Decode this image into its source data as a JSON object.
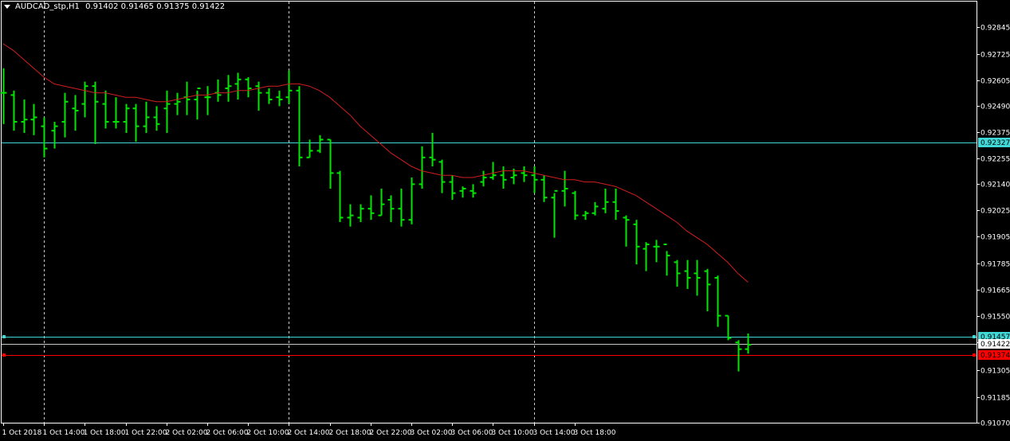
{
  "header": {
    "symbol": "AUDCAD_stp,H1",
    "ohlc": "0.91402 0.91465 0.91375 0.91422"
  },
  "colors": {
    "background": "#000000",
    "bar": "#00e600",
    "ma": "#d21e1e",
    "hline": "#40d7d7",
    "current": "#c8c8c8",
    "sell": "#ff0000",
    "axis": "#ffffff",
    "separator": "#c8c8c8"
  },
  "chart_data": {
    "type": "ohlc",
    "symbol": "AUDCAD_stp",
    "timeframe": "H1",
    "ylim": [
      0.9107,
      0.9292
    ],
    "yticks": [
      "0.92845",
      "0.92725",
      "0.92605",
      "0.92490",
      "0.92375",
      "0.92255",
      "0.92140",
      "0.92025",
      "0.91905",
      "0.91785",
      "0.91665",
      "0.91550",
      "0.91430",
      "0.91305",
      "0.91185",
      "0.91070"
    ],
    "xticks": [
      "1 Oct 2018",
      "1 Oct 14:00",
      "1 Oct 18:00",
      "1 Oct 22:00",
      "2 Oct 02:00",
      "2 Oct 06:00",
      "2 Oct 10:00",
      "2 Oct 14:00",
      "2 Oct 18:00",
      "2 Oct 22:00",
      "3 Oct 02:00",
      "3 Oct 06:00",
      "3 Oct 10:00",
      "3 Oct 14:00",
      "3 Oct 18:00"
    ],
    "x_start_hour": 10,
    "day_separators_hour": [
      14,
      38,
      62
    ],
    "bars": [
      [
        0.9255,
        0.9266,
        0.9241,
        0.9255
      ],
      [
        0.9254,
        0.9256,
        0.9238,
        0.9242
      ],
      [
        0.9242,
        0.9252,
        0.9237,
        0.9243
      ],
      [
        0.9243,
        0.925,
        0.9236,
        0.9244
      ],
      [
        0.924,
        0.9244,
        0.9226,
        0.923
      ],
      [
        0.9238,
        0.9242,
        0.923,
        0.924
      ],
      [
        0.9242,
        0.9255,
        0.9235,
        0.9251
      ],
      [
        0.9248,
        0.9254,
        0.9238,
        0.9247
      ],
      [
        0.925,
        0.926,
        0.9244,
        0.9258
      ],
      [
        0.9258,
        0.926,
        0.9232,
        0.9251
      ],
      [
        0.925,
        0.9256,
        0.9239,
        0.9242
      ],
      [
        0.9242,
        0.9253,
        0.9239,
        0.9242
      ],
      [
        0.9242,
        0.925,
        0.9237,
        0.9248
      ],
      [
        0.9248,
        0.925,
        0.9233,
        0.924
      ],
      [
        0.924,
        0.9251,
        0.9237,
        0.9244
      ],
      [
        0.9244,
        0.9249,
        0.9238,
        0.9241
      ],
      [
        0.9248,
        0.9256,
        0.9237,
        0.925
      ],
      [
        0.925,
        0.9255,
        0.9245,
        0.9251
      ],
      [
        0.9253,
        0.926,
        0.9245,
        0.9252
      ],
      [
        0.9252,
        0.9256,
        0.9243,
        0.9257
      ],
      [
        0.9253,
        0.9258,
        0.9245,
        0.9253
      ],
      [
        0.9255,
        0.9261,
        0.9251,
        0.9254
      ],
      [
        0.9257,
        0.9263,
        0.9251,
        0.9258
      ],
      [
        0.9259,
        0.9264,
        0.9252,
        0.9261
      ],
      [
        0.9261,
        0.9262,
        0.9253,
        0.9257
      ],
      [
        0.9258,
        0.926,
        0.9247,
        0.9255
      ],
      [
        0.9255,
        0.9257,
        0.925,
        0.9252
      ],
      [
        0.9253,
        0.9256,
        0.9249,
        0.9252
      ],
      [
        0.9253,
        0.9265,
        0.925,
        0.9256
      ],
      [
        0.9256,
        0.9258,
        0.9222,
        0.9226
      ],
      [
        0.9226,
        0.9234,
        0.9226,
        0.9229
      ],
      [
        0.9229,
        0.9236,
        0.9228,
        0.9234
      ],
      [
        0.9234,
        0.9234,
        0.9212,
        0.9219
      ],
      [
        0.9219,
        0.922,
        0.9197,
        0.9199
      ],
      [
        0.9199,
        0.9205,
        0.9195,
        0.92
      ],
      [
        0.9199,
        0.9205,
        0.9197,
        0.9203
      ],
      [
        0.9203,
        0.9209,
        0.9198,
        0.9201
      ],
      [
        0.92,
        0.9212,
        0.92,
        0.9205
      ],
      [
        0.9207,
        0.9209,
        0.9197,
        0.9203
      ],
      [
        0.9203,
        0.9212,
        0.9195,
        0.9198
      ],
      [
        0.9198,
        0.9217,
        0.9196,
        0.9214
      ],
      [
        0.9214,
        0.9231,
        0.9212,
        0.9226
      ],
      [
        0.9226,
        0.9237,
        0.9222,
        0.9225
      ],
      [
        0.9224,
        0.9225,
        0.921,
        0.9215
      ],
      [
        0.9215,
        0.9218,
        0.9207,
        0.921
      ],
      [
        0.9211,
        0.9213,
        0.9208,
        0.9212
      ],
      [
        0.9211,
        0.9214,
        0.9208,
        0.921
      ],
      [
        0.9215,
        0.922,
        0.9213,
        0.9217
      ],
      [
        0.9217,
        0.9224,
        0.9216,
        0.9218
      ],
      [
        0.9218,
        0.9222,
        0.9212,
        0.9216
      ],
      [
        0.9217,
        0.9221,
        0.9214,
        0.9218
      ],
      [
        0.9219,
        0.9222,
        0.9215,
        0.9218
      ],
      [
        0.9218,
        0.9222,
        0.921,
        0.9216
      ],
      [
        0.9216,
        0.9218,
        0.9206,
        0.9208
      ],
      [
        0.9208,
        0.921,
        0.919,
        0.9211
      ],
      [
        0.9211,
        0.922,
        0.9204,
        0.9212
      ],
      [
        0.921,
        0.9211,
        0.9198,
        0.92
      ],
      [
        0.92,
        0.9202,
        0.9198,
        0.9201
      ],
      [
        0.9201,
        0.9206,
        0.92,
        0.9204
      ],
      [
        0.9203,
        0.9212,
        0.9201,
        0.9206
      ],
      [
        0.9206,
        0.9212,
        0.9198,
        0.9202
      ],
      [
        0.9199,
        0.92,
        0.9186,
        0.9198
      ],
      [
        0.9196,
        0.9198,
        0.9178,
        0.9186
      ],
      [
        0.9185,
        0.9188,
        0.9175,
        0.9187
      ],
      [
        0.9186,
        0.9189,
        0.9179,
        0.9186
      ],
      [
        0.9187,
        0.9184,
        0.9173,
        0.9182
      ],
      [
        0.9179,
        0.918,
        0.9168,
        0.9174
      ],
      [
        0.9175,
        0.918,
        0.9167,
        0.9172
      ],
      [
        0.9174,
        0.918,
        0.9164,
        0.9172
      ],
      [
        0.9175,
        0.9176,
        0.9157,
        0.9169
      ],
      [
        0.9172,
        0.9173,
        0.915,
        0.9155
      ],
      [
        0.9155,
        0.9155,
        0.9144,
        0.9145
      ],
      [
        0.9143,
        0.9144,
        0.913,
        0.914
      ],
      [
        0.914,
        0.9147,
        0.9138,
        0.9142
      ]
    ],
    "moving_average": [
      0.9277,
      0.9274,
      0.927,
      0.9266,
      0.9262,
      0.9259,
      0.9258,
      0.9257,
      0.9256,
      0.9255,
      0.9255,
      0.9254,
      0.9253,
      0.9253,
      0.9252,
      0.9251,
      0.9251,
      0.9252,
      0.9253,
      0.9254,
      0.9254,
      0.9255,
      0.9255,
      0.9256,
      0.9256,
      0.9257,
      0.9258,
      0.9258,
      0.9259,
      0.9259,
      0.9258,
      0.9256,
      0.9253,
      0.9249,
      0.9245,
      0.924,
      0.9236,
      0.9232,
      0.9228,
      0.9225,
      0.9222,
      0.922,
      0.9219,
      0.9218,
      0.9218,
      0.9217,
      0.9217,
      0.9218,
      0.9219,
      0.922,
      0.922,
      0.922,
      0.9219,
      0.9218,
      0.9217,
      0.9216,
      0.9216,
      0.9215,
      0.9215,
      0.9214,
      0.9213,
      0.9211,
      0.9209,
      0.9206,
      0.9203,
      0.92,
      0.9197,
      0.9193,
      0.919,
      0.9187,
      0.9183,
      0.9179,
      0.9174,
      0.917
    ],
    "hlines": [
      {
        "name": "level-upper",
        "value": 0.92327,
        "label": "0.92327",
        "color": "#40d7d7",
        "tag_bg": "#40d7d7",
        "tag_fg": "#000000"
      },
      {
        "name": "level-ask",
        "value": 0.91457,
        "label": "0.91457",
        "color": "#40d7d7",
        "tag_bg": "#40d7d7",
        "tag_fg": "#000000"
      },
      {
        "name": "level-current",
        "value": 0.91422,
        "label": "0.91422",
        "color": "#c8c8c8",
        "tag_bg": "#ffffff",
        "tag_fg": "#000000"
      },
      {
        "name": "level-sell",
        "value": 0.91374,
        "label": "0.91374",
        "color": "#ff0000",
        "tag_bg": "#ff0000",
        "tag_fg": "#000000"
      }
    ]
  }
}
